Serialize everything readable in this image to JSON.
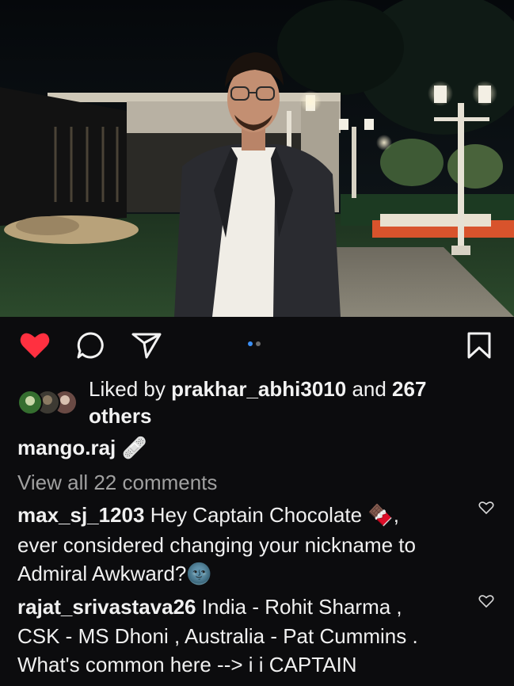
{
  "post": {
    "dots": 2,
    "active_dot": 0,
    "liked": true
  },
  "likes": {
    "prefix": "Liked by ",
    "user": "prakhar_abhi3010",
    "middle": " and ",
    "count": "267",
    "suffix": "others"
  },
  "caption": {
    "username": "mango.raj",
    "emoji": "🩹"
  },
  "comments_link": "View all 22 comments",
  "comments": [
    {
      "username": "max_sj_1203",
      "text": " Hey Captain Chocolate ",
      "emoji": "🍫",
      "text2": ",",
      "line2": "ever considered changing your nickname to",
      "line3": "Admiral Awkward?",
      "emoji2": "🌚"
    },
    {
      "username": "rajat_srivastava26",
      "text": " India - Rohit Sharma ,",
      "line2": "CSK - MS Dhoni , Australia - Pat Cummins .",
      "line3": "What's common here --> i i CAPTAIN"
    }
  ],
  "icons": [
    "heart-icon",
    "comment-icon",
    "share-icon",
    "save-icon",
    "comment-heart-icon"
  ],
  "colors": {
    "background": "#0c0c0e",
    "like_red": "#ff3040",
    "muted_text": "#a0a0a0",
    "carousel_active": "#3b8ff5"
  }
}
